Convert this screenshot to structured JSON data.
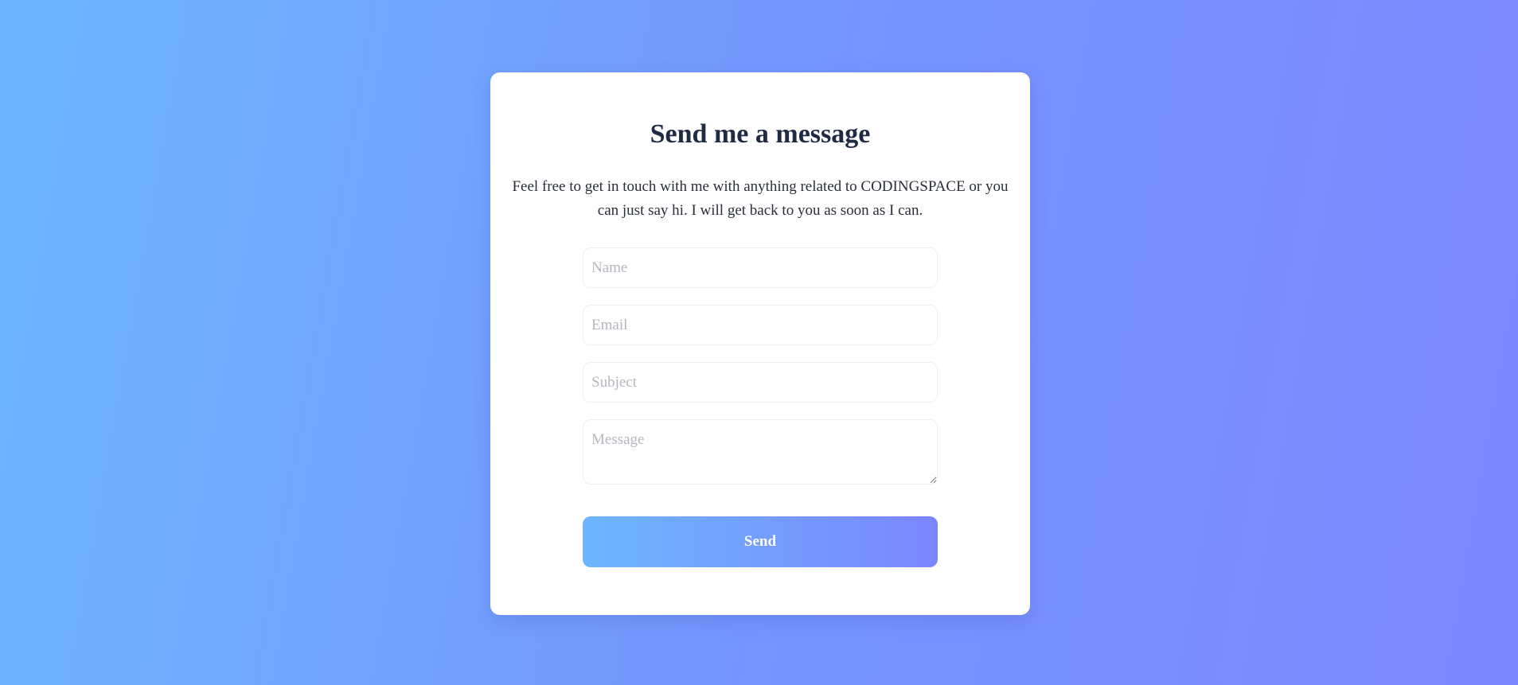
{
  "contact": {
    "title": "Send me a message",
    "description": "Feel free to get in touch with me with anything related to CODINGSPACE or you can just say hi. I will get back to you as soon as I can.",
    "fields": {
      "name": {
        "placeholder": "Name",
        "value": ""
      },
      "email": {
        "placeholder": "Email",
        "value": ""
      },
      "subject": {
        "placeholder": "Subject",
        "value": ""
      },
      "message": {
        "placeholder": "Message",
        "value": ""
      }
    },
    "send_label": "Send"
  },
  "colors": {
    "background_start": "#6db6ff",
    "background_end": "#7c86fe",
    "title": "#1f2a44",
    "button_start": "#6db6ff",
    "button_end": "#7b86fe"
  }
}
